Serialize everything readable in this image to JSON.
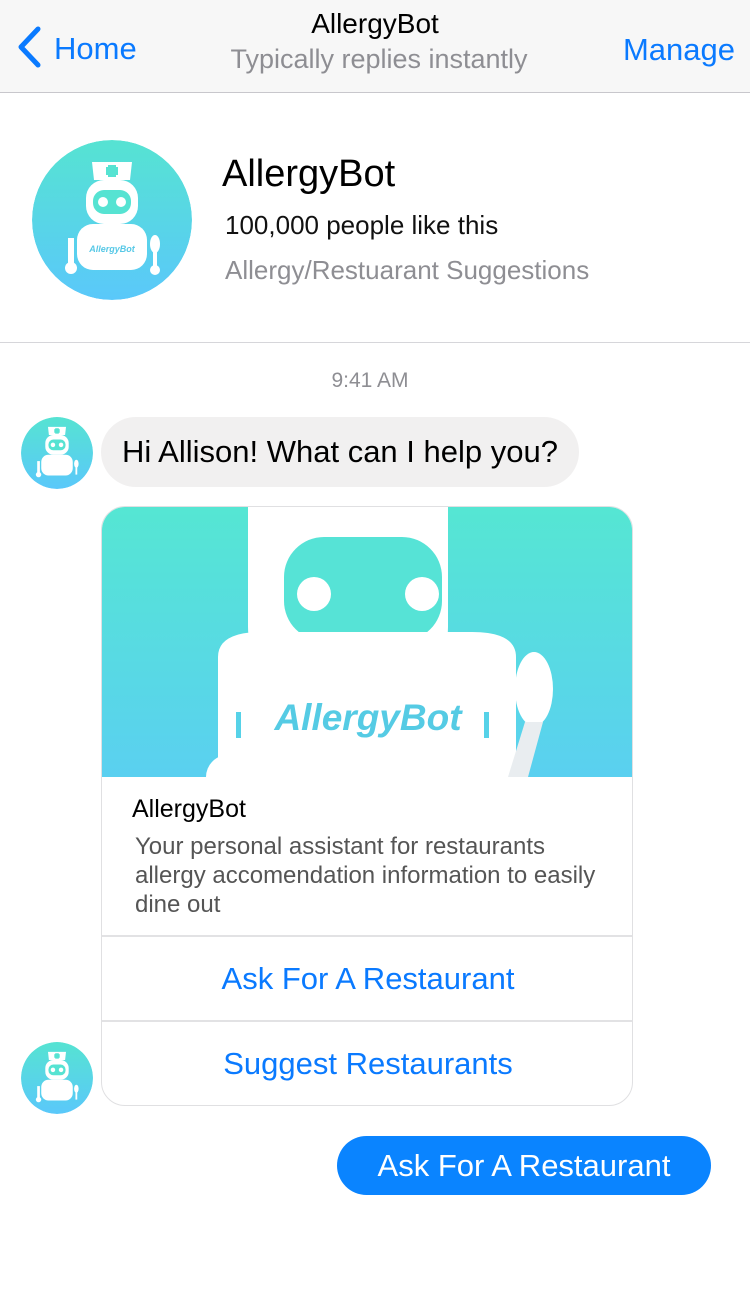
{
  "nav": {
    "back_label": "Home",
    "title": "AllergyBot",
    "subtitle": "Typically replies instantly",
    "manage_label": "Manage"
  },
  "profile": {
    "name": "AllergyBot",
    "likes": "100,000 people like this",
    "category": "Allergy/Restuarant Suggestions",
    "logo_text": "AllergyBot"
  },
  "chat": {
    "timestamp": "9:41 AM",
    "bot_message": "Hi Allison! What can I help you?",
    "card": {
      "hero_text": "AllergyBot",
      "title": "AllergyBot",
      "description": "Your personal assistant for restaurants allergy accomendation information to easily dine out",
      "buttons": [
        "Ask For A Restaurant",
        "Suggest Restaurants"
      ]
    },
    "user_message": "Ask For A Restaurant"
  },
  "colors": {
    "accent": "#0a7aff",
    "bubble_user": "#0a84ff",
    "bubble_bot": "#f1f0f0",
    "brand_teal": "#56e3d2",
    "brand_blue": "#5ac8fa"
  }
}
